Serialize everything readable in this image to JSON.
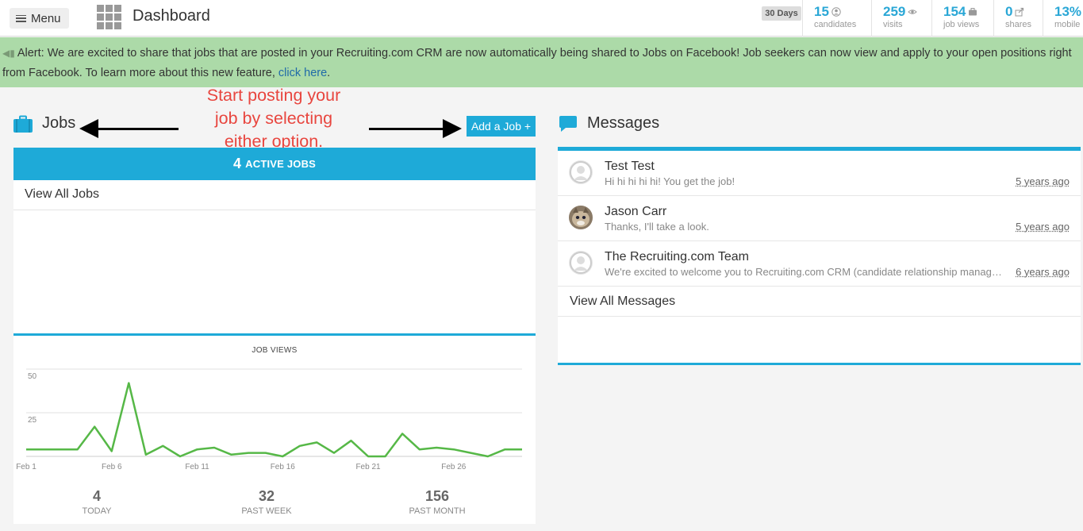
{
  "header": {
    "menu_label": "Menu",
    "title": "Dashboard",
    "range_label": "30 Days",
    "stats": [
      {
        "value": "15",
        "label": "candidates",
        "icon": "user-circle-icon"
      },
      {
        "value": "259",
        "label": "visits",
        "icon": "eye-icon"
      },
      {
        "value": "154",
        "label": "job views",
        "icon": "briefcase-icon"
      },
      {
        "value": "0",
        "label": "shares",
        "icon": "share-icon"
      },
      {
        "value": "13%",
        "label": "mobile",
        "icon": ""
      }
    ],
    "accent_color": "#1eaad8"
  },
  "alert": {
    "text": "Alert: We are excited to share that jobs that are posted in your Recruiting.com CRM are now automatically being shared to Jobs on Facebook! Job seekers can now view and apply to your open positions right",
    "text2": "from Facebook. To learn more about this new feature,",
    "link": "click here",
    "after_link": ".",
    "bg_color": "#acdaa8"
  },
  "jobs": {
    "title": "Jobs",
    "annotation": [
      "Start posting your",
      "job by selecting",
      "either option."
    ],
    "add_button": "Add a Job +",
    "active_count": "4",
    "active_label": "Active Jobs",
    "view_all": "View All Jobs"
  },
  "chart_data": {
    "type": "line",
    "title": "JOB VIEWS",
    "x_ticks": [
      "Feb 1",
      "Feb 6",
      "Feb 11",
      "Feb 16",
      "Feb 21",
      "Feb 26"
    ],
    "y_ticks": [
      50,
      25
    ],
    "ylim": [
      0,
      50
    ],
    "x": [
      1,
      2,
      3,
      4,
      5,
      6,
      7,
      8,
      9,
      10,
      11,
      12,
      13,
      14,
      15,
      16,
      17,
      18,
      19,
      20,
      21,
      22,
      23,
      24,
      25,
      26,
      27,
      28,
      29,
      30
    ],
    "series": [
      {
        "values": [
          4,
          4,
          4,
          4,
          17,
          3,
          42,
          1,
          6,
          0,
          4,
          5,
          1,
          2,
          2,
          0,
          6,
          8,
          2,
          9,
          0,
          0,
          13,
          4,
          5,
          4,
          2,
          0,
          4,
          4
        ],
        "color": "#56b847"
      }
    ],
    "grid": true
  },
  "summary": [
    {
      "value": "4",
      "label": "Today"
    },
    {
      "value": "32",
      "label": "Past Week"
    },
    {
      "value": "156",
      "label": "Past Month"
    }
  ],
  "messages": {
    "title": "Messages",
    "items": [
      {
        "name": "Test Test",
        "snippet": "Hi hi hi hi hi! You get the job!",
        "time": "5 years ago",
        "avatar": "default-avatar-icon"
      },
      {
        "name": "Jason Carr",
        "snippet": "Thanks, I'll take a look.",
        "time": "5 years ago",
        "avatar": "cat-photo-avatar"
      },
      {
        "name": "The Recruiting.com Team",
        "snippet": "We're excited to welcome you to Recruiting.com CRM (candidate relationship management)",
        "time": "6 years ago",
        "avatar": "default-avatar-icon"
      }
    ],
    "view_all": "View All Messages"
  }
}
